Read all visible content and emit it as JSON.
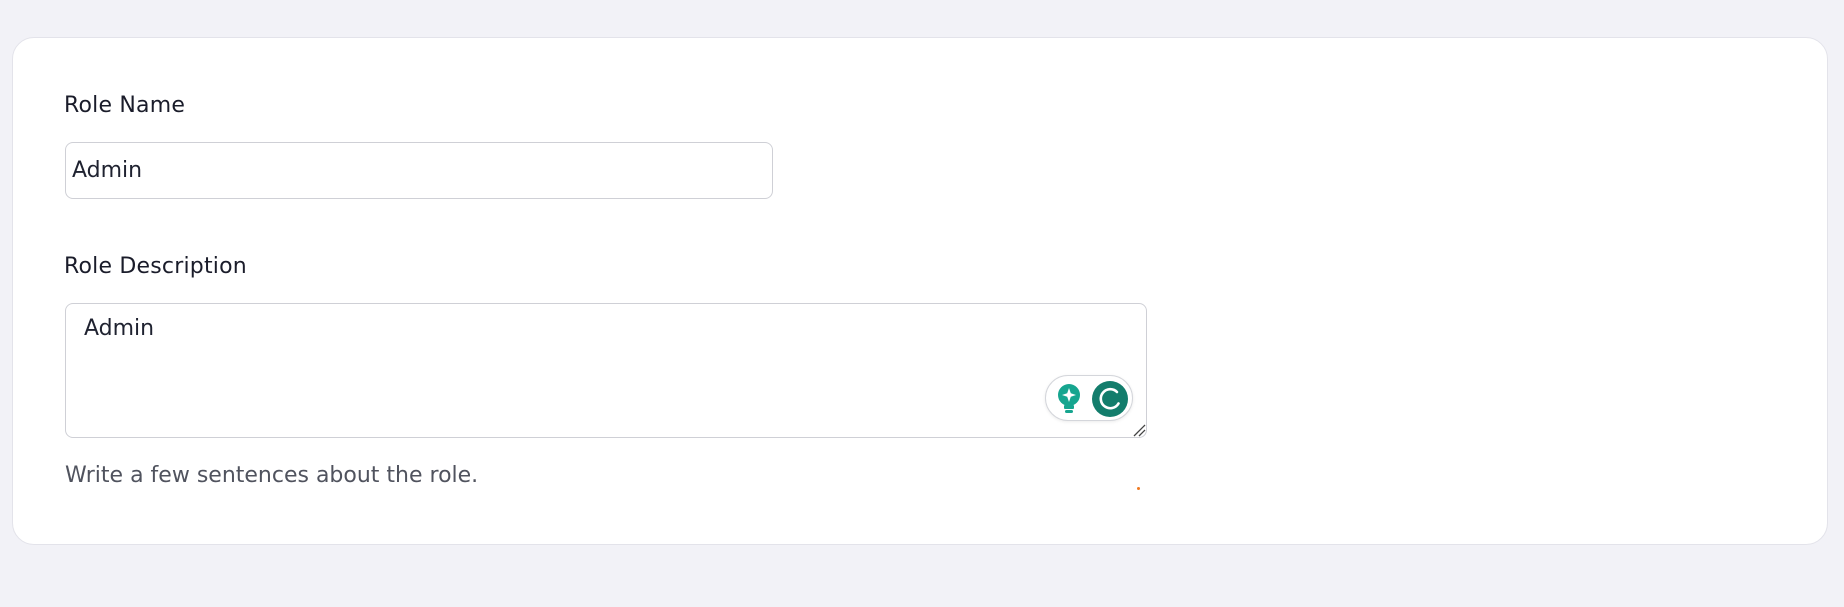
{
  "form": {
    "role_name_label": "Role Name",
    "role_name_value": "Admin",
    "role_description_label": "Role Description",
    "role_description_value": "Admin",
    "role_description_helper": "Write a few sentences about the role."
  },
  "grammar_widget": {
    "suggestion_icon": "lightbulb-sparkle-icon",
    "assistant_icon": "grammarly-g-icon",
    "accent_color": "#137d6c",
    "bulb_color": "#16a58f"
  },
  "colors": {
    "page_background": "#f2f2f7",
    "card_background": "#ffffff",
    "input_border": "#cfd0d6",
    "label_text": "#1a1c2a",
    "helper_text": "#50535e"
  }
}
